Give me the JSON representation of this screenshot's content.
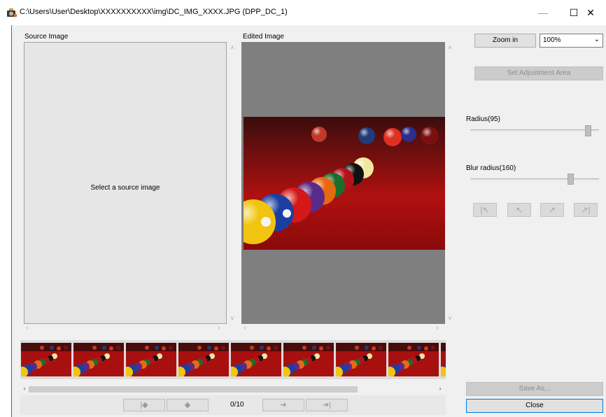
{
  "window": {
    "title": "C:\\Users\\User\\Desktop\\XXXXXXXXXX\\img\\DC_IMG_XXXX.JPG (DPP_DC_1)",
    "minimize": "—",
    "maximize": "☐",
    "close": "✕"
  },
  "source": {
    "label": "Source Image",
    "message": "Select a source image"
  },
  "edited": {
    "label": "Edited Image"
  },
  "navigation": {
    "first": "|◆",
    "prev": "◆",
    "counter": "0/10",
    "next": "➔",
    "last": "➔|"
  },
  "controls": {
    "zoom_in": "Zoom in",
    "zoom_level": "100%",
    "set_area": "Set Adjustment Area",
    "radius_label": "Radius(95)",
    "radius_value": 95,
    "blur_label": "Blur radius(160)",
    "blur_value": 160,
    "save_as": "Save As...",
    "close": "Close"
  },
  "history": {
    "first": "|↖",
    "undo": "↖",
    "redo": "↗",
    "last": "↗|"
  },
  "thumbnails_count": 9
}
